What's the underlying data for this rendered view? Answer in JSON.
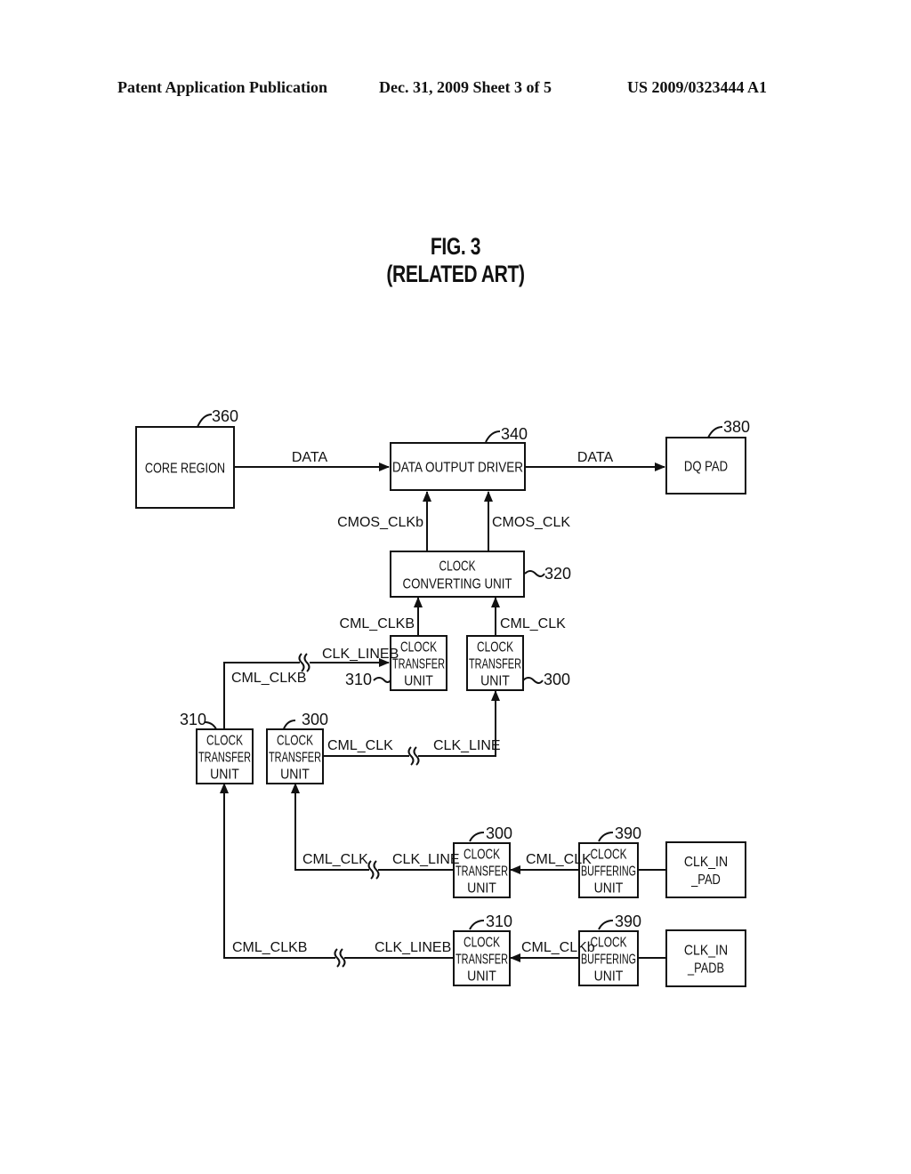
{
  "header": {
    "publication": "Patent Application Publication",
    "date_sheet": "Dec. 31, 2009   Sheet 3 of 5",
    "patent_number": "US 2009/0323444 A1"
  },
  "figure": {
    "title": "FIG. 3",
    "subtitle": "(RELATED ART)"
  },
  "blocks": {
    "core_region": {
      "label": [
        "CORE REGION"
      ],
      "ref": "360"
    },
    "data_output_driver": {
      "label": [
        "DATA OUTPUT DRIVER"
      ],
      "ref": "340"
    },
    "dq_pad": {
      "label": [
        "DQ PAD"
      ],
      "ref": "380"
    },
    "clock_converting_unit": {
      "label": [
        "CLOCK",
        "CONVERTING UNIT"
      ],
      "ref": "320"
    },
    "ctu_310_top": {
      "label": [
        "CLOCK",
        "TRANSFER",
        "UNIT"
      ],
      "ref": "310"
    },
    "ctu_300_top": {
      "label": [
        "CLOCK",
        "TRANSFER",
        "UNIT"
      ],
      "ref": "300"
    },
    "ctu_310_mid": {
      "label": [
        "CLOCK",
        "TRANSFER",
        "UNIT"
      ],
      "ref": "310"
    },
    "ctu_300_mid": {
      "label": [
        "CLOCK",
        "TRANSFER",
        "UNIT"
      ],
      "ref": "300"
    },
    "ctu_300_low": {
      "label": [
        "CLOCK",
        "TRANSFER",
        "UNIT"
      ],
      "ref": "300"
    },
    "ctu_310_low": {
      "label": [
        "CLOCK",
        "TRANSFER",
        "UNIT"
      ],
      "ref": "310"
    },
    "cbu_390_a": {
      "label": [
        "CLOCK",
        "BUFFERING",
        "UNIT"
      ],
      "ref": "390"
    },
    "cbu_390_b": {
      "label": [
        "CLOCK",
        "BUFFERING",
        "UNIT"
      ],
      "ref": "390"
    },
    "clk_in_pad": {
      "label": [
        "CLK_IN",
        "_PAD"
      ]
    },
    "clk_in_padb": {
      "label": [
        "CLK_IN",
        "_PADB"
      ]
    }
  },
  "signals": {
    "data_in": "DATA",
    "data_out": "DATA",
    "cmos_clkb": "CMOS_CLKb",
    "cmos_clk": "CMOS_CLK",
    "cml_clkb_top": "CML_CLKB",
    "cml_clk_top": "CML_CLK",
    "clk_lineb_top": "CLK_LINEB",
    "cml_clkb_left": "CML_CLKB",
    "cml_clk_mid": "CML_CLK",
    "clk_line_mid": "CLK_LINE",
    "cml_clk_low": "CML_CLK",
    "clk_line_low": "CLK_LINE",
    "cml_clk_buf": "CML_CLK",
    "cml_clkb_bottom": "CML_CLKB",
    "clk_lineb_bottom": "CLK_LINEB",
    "cml_clkb_buf": "CML_CLKb"
  }
}
